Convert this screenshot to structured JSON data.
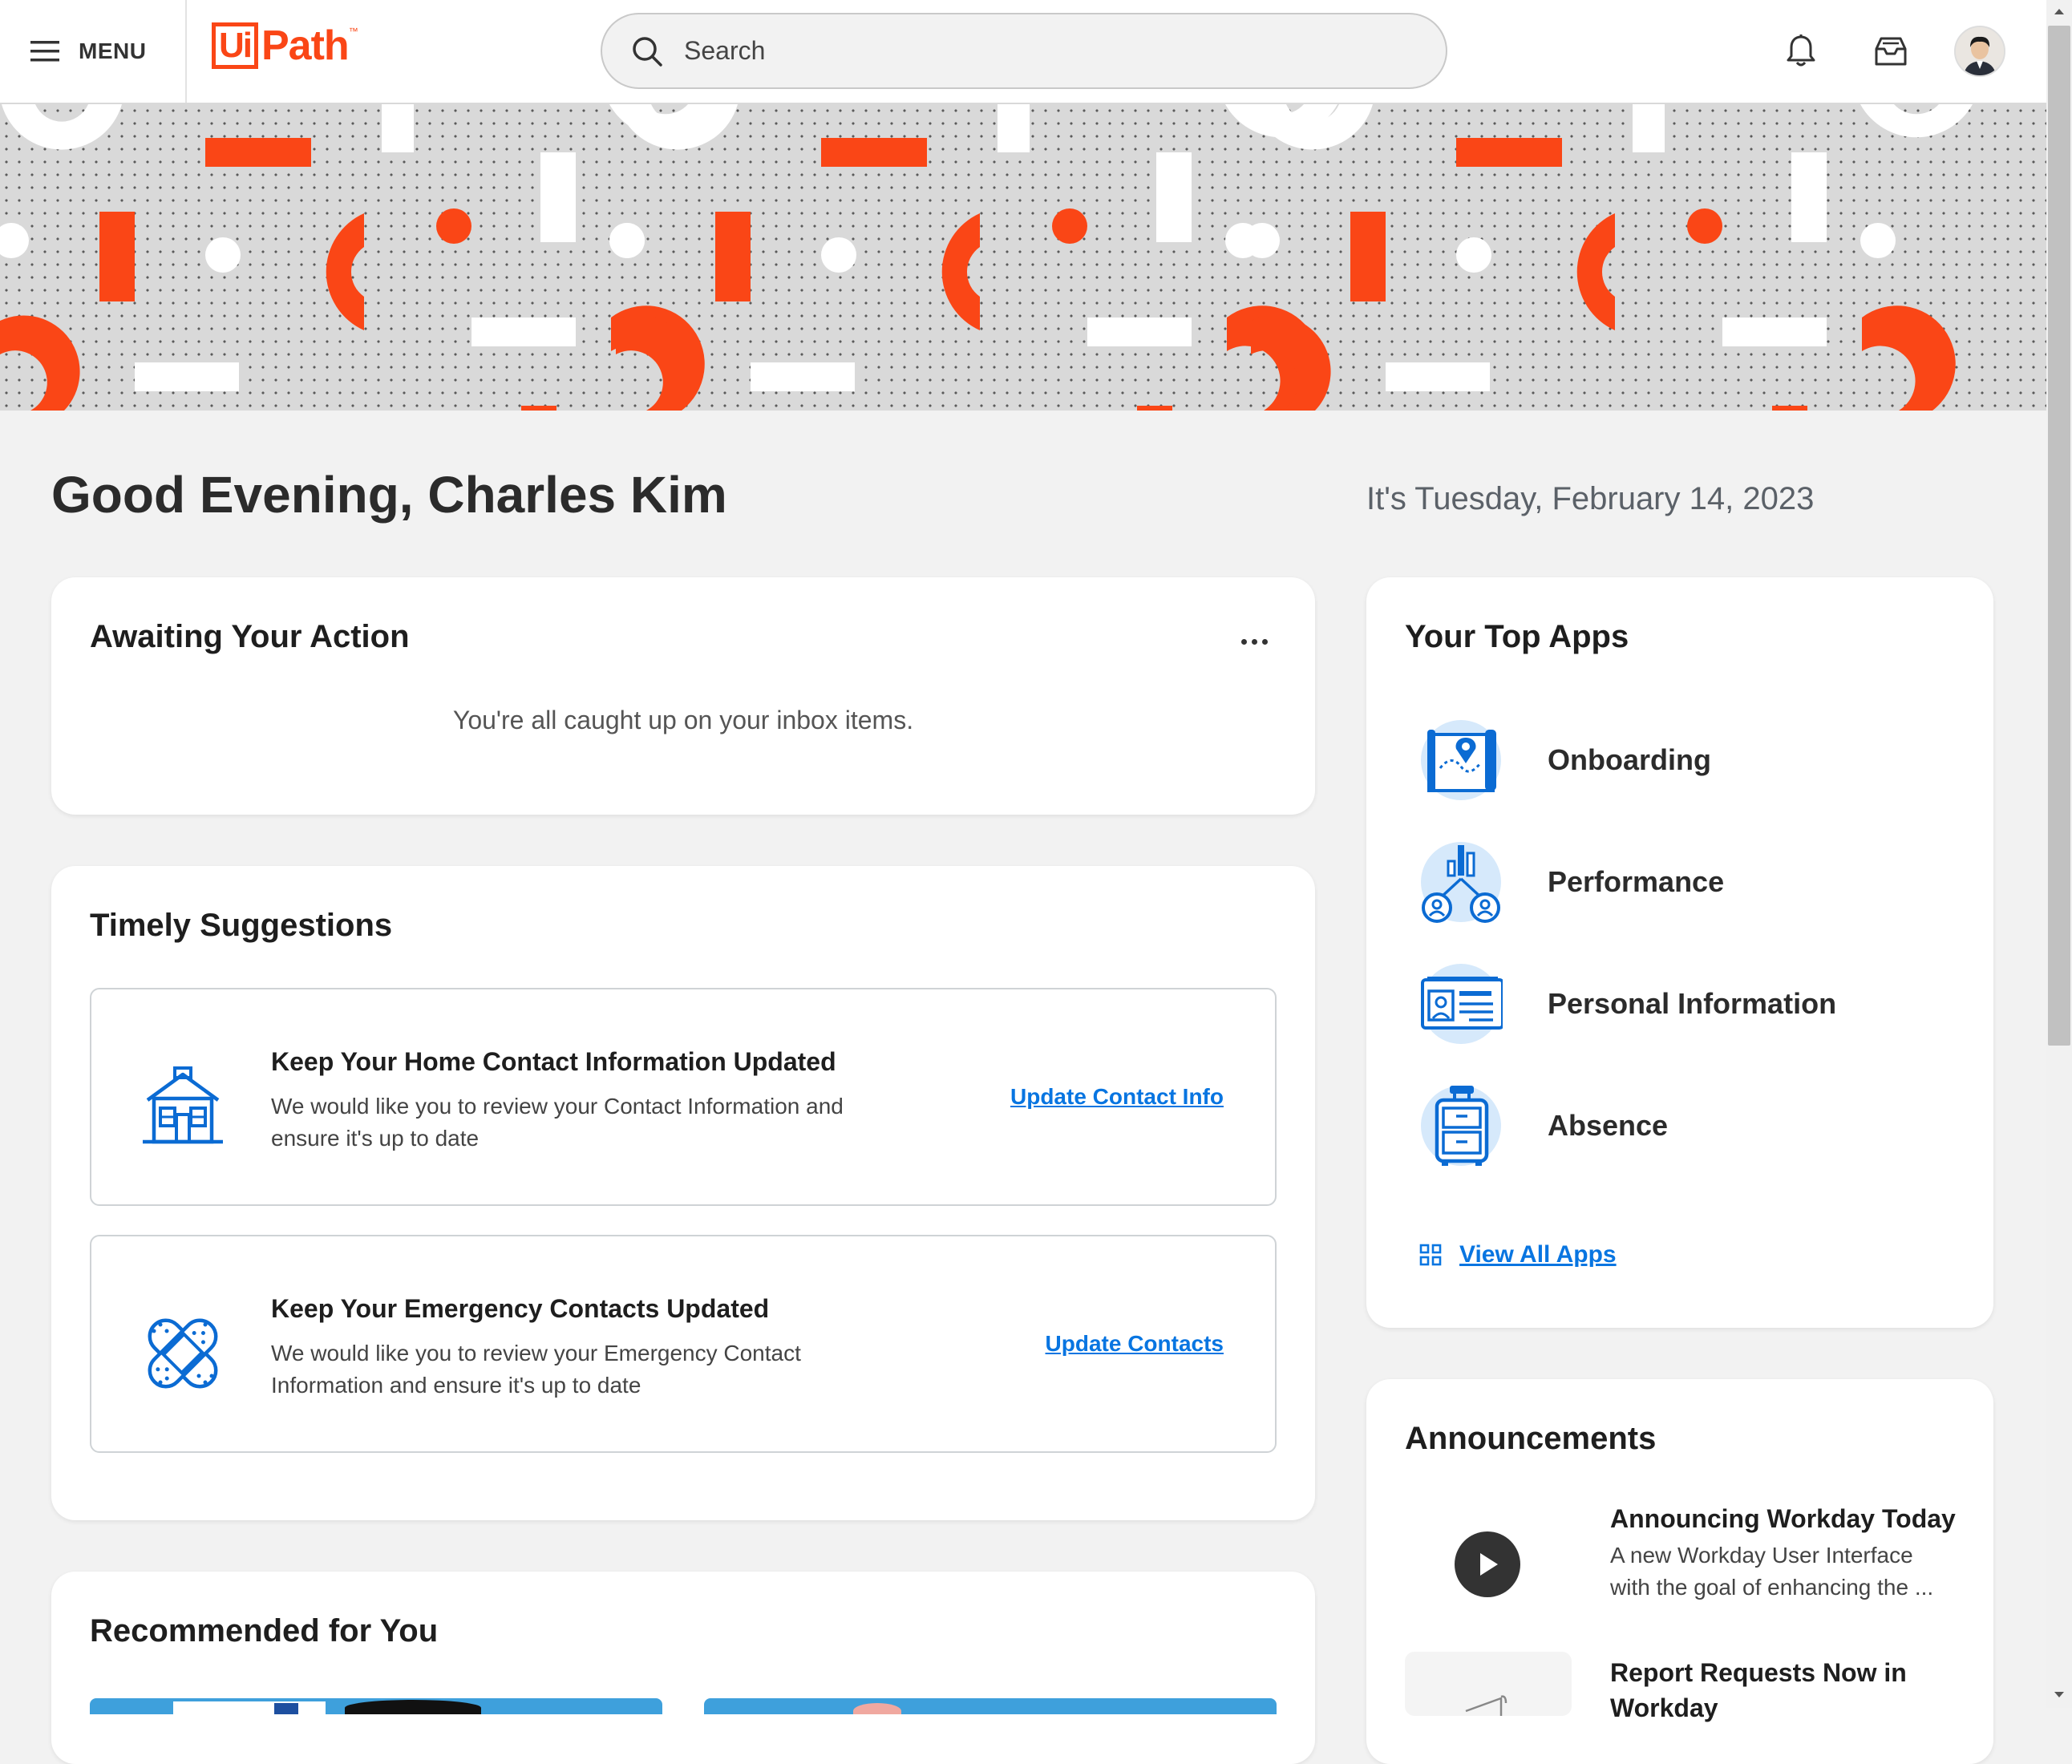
{
  "header": {
    "menu_label": "MENU",
    "logo_ui": "Ui",
    "logo_path": "Path",
    "logo_tm": "™",
    "search_placeholder": "Search"
  },
  "greeting": "Good Evening, Charles Kim",
  "date": "It's Tuesday, February 14, 2023",
  "awaiting": {
    "title": "Awaiting Your Action",
    "empty_message": "You're all caught up on your inbox items."
  },
  "suggestions": {
    "title": "Timely Suggestions",
    "items": [
      {
        "title": "Keep Your Home Contact Information Updated",
        "description": "We would like you to review your Contact Information and ensure it's up to date",
        "link": "Update Contact Info",
        "icon": "house-icon"
      },
      {
        "title": "Keep Your Emergency Contacts Updated",
        "description": "We would like you to review your Emergency Contact Information and ensure it's up to date",
        "link": "Update Contacts",
        "icon": "bandage-icon"
      }
    ]
  },
  "recommended": {
    "title": "Recommended for You"
  },
  "top_apps": {
    "title": "Your Top Apps",
    "apps": [
      {
        "label": "Onboarding",
        "icon": "map-pin-icon"
      },
      {
        "label": "Performance",
        "icon": "people-chart-icon"
      },
      {
        "label": "Personal Information",
        "icon": "id-card-icon"
      },
      {
        "label": "Absence",
        "icon": "suitcase-icon"
      }
    ],
    "view_all": "View All Apps"
  },
  "announcements": {
    "title": "Announcements",
    "items": [
      {
        "title": "Announcing Workday Today",
        "description": "A new Workday User Interface with the goal of enhancing the ..."
      },
      {
        "title": "Report Requests Now in Workday",
        "description": ""
      }
    ]
  },
  "colors": {
    "brand": "#fa4616",
    "link": "#0875e1",
    "icon_blue": "#0b6bd3",
    "icon_bg": "#d6e9fb"
  }
}
